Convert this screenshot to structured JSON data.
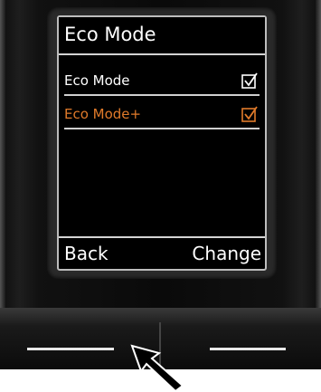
{
  "screen": {
    "title": "Eco Mode",
    "menu": [
      {
        "label": "Eco Mode",
        "checked": true,
        "selected": false
      },
      {
        "label": "Eco Mode+",
        "checked": true,
        "selected": true
      }
    ],
    "softkeys": {
      "left": "Back",
      "right": "Change"
    }
  },
  "colors": {
    "highlight": "#e07a2a",
    "text": "#ffffff",
    "screen_bg": "#000000"
  },
  "icons": {
    "checkbox": "checkbox-checked-icon",
    "pointer": "pointer-arrow-icon"
  }
}
